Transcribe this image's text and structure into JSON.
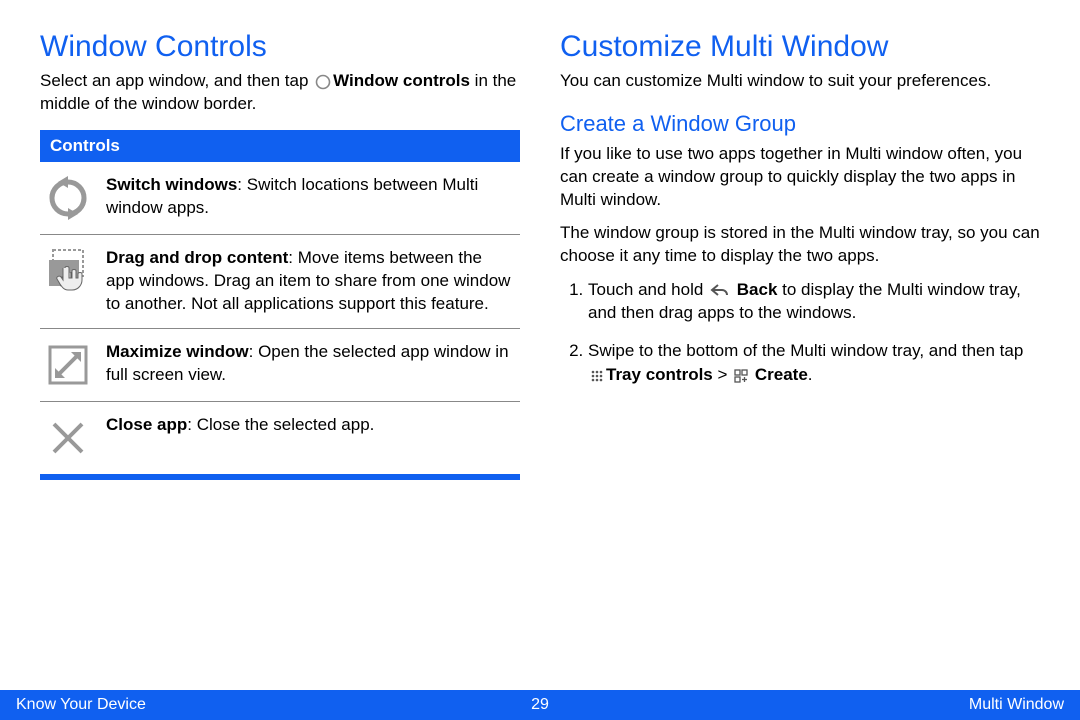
{
  "left": {
    "heading": "Window Controls",
    "intro_pre": "Select an app window, and then tap ",
    "intro_bold": "Window controls",
    "intro_post": " in the middle of the window border.",
    "controls_header": "Controls",
    "controls": [
      {
        "icon": "switch-icon",
        "title": "Switch windows",
        "desc": ": Switch locations between Multi window apps."
      },
      {
        "icon": "dragdrop-icon",
        "title": "Drag and drop content",
        "desc": ": Move items between the app windows. Drag an item to share from one window to another. Not all applications support this feature."
      },
      {
        "icon": "maximize-icon",
        "title": "Maximize window",
        "desc": ": Open the selected app window in full screen view."
      },
      {
        "icon": "close-icon",
        "title": "Close app",
        "desc": ": Close the selected app."
      }
    ]
  },
  "right": {
    "heading": "Customize Multi Window",
    "intro": "You can customize Multi window to suit your preferences.",
    "sub1": "Create a Window Group",
    "sub1_p1": "If you like to use two apps together in Multi window often, you can create a window group to quickly display the two apps in Multi window.",
    "sub1_p2": "The window group is stored in the Multi window tray, so you can choose it any time to display the two apps.",
    "step1_pre": "Touch and hold ",
    "step1_bold": "Back",
    "step1_post": " to display the Multi window tray, and then drag apps to the windows.",
    "step2_pre": "Swipe to the bottom of the Multi window tray, and then tap ",
    "step2_bold1": "Tray controls",
    "step2_mid": " > ",
    "step2_bold2": "Create",
    "step2_end": "."
  },
  "footer": {
    "left": "Know Your Device",
    "center": "29",
    "right": "Multi Window"
  }
}
